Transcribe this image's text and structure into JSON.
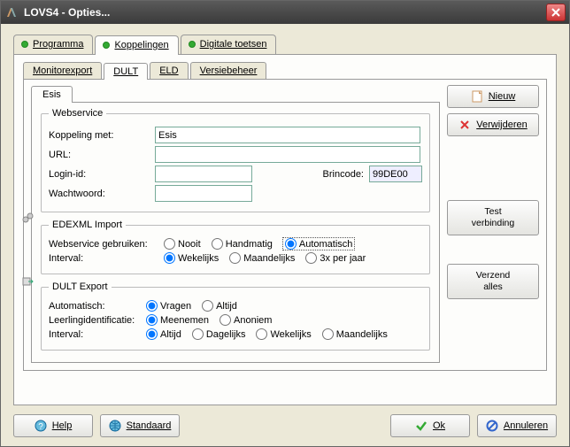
{
  "window": {
    "title": "LOVS4 - Opties..."
  },
  "mainTabs": {
    "programma": "Programma",
    "koppelingen": "Koppelingen",
    "digitale": "Digitale toetsen"
  },
  "subTabs": {
    "monitorexport": "Monitorexport",
    "dult": "DULT",
    "eld": "ELD",
    "versiebeheer": "Versiebeheer"
  },
  "innerTab": {
    "esis": "Esis"
  },
  "webservice": {
    "legend": "Webservice",
    "koppeling_label": "Koppeling met:",
    "koppeling_value": "Esis",
    "url_label": "URL:",
    "url_value": "",
    "login_label": "Login-id:",
    "login_value": "",
    "brincode_label": "Brincode:",
    "brincode_value": "99DE00",
    "wachtwoord_label": "Wachtwoord:",
    "wachtwoord_value": ""
  },
  "edexml": {
    "legend": "EDEXML Import",
    "gebruiken_label": "Webservice gebruiken:",
    "opts": {
      "nooit": "Nooit",
      "handmatig": "Handmatig",
      "automatisch": "Automatisch"
    },
    "interval_label": "Interval:",
    "interval_opts": {
      "wekelijks": "Wekelijks",
      "maandelijks": "Maandelijks",
      "perjaar": "3x per jaar"
    }
  },
  "dultexport": {
    "legend": "DULT Export",
    "auto_label": "Automatisch:",
    "auto_opts": {
      "vragen": "Vragen",
      "altijd": "Altijd"
    },
    "leerling_label": "Leerlingidentificatie:",
    "leerling_opts": {
      "meenemen": "Meenemen",
      "anoniem": "Anoniem"
    },
    "interval_label": "Interval:",
    "interval_opts": {
      "altijd": "Altijd",
      "dagelijks": "Dagelijks",
      "wekelijks": "Wekelijks",
      "maandelijks": "Maandelijks"
    }
  },
  "sidebar": {
    "nieuw": "Nieuw",
    "verwijderen": "Verwijderen",
    "test1": "Test",
    "test2": "verbinding",
    "verzend1": "Verzend",
    "verzend2": "alles"
  },
  "footer": {
    "help": "Help",
    "standaard": "Standaard",
    "ok": "Ok",
    "annuleren": "Annuleren"
  }
}
